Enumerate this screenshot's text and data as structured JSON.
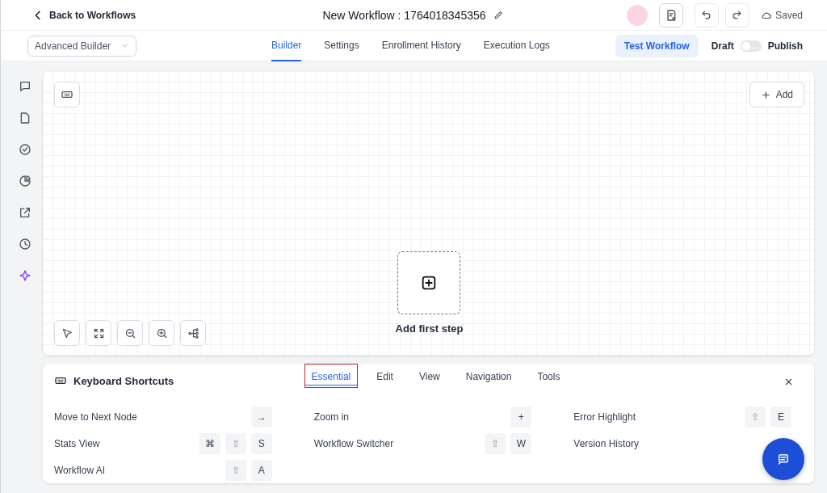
{
  "header": {
    "back_link": "Back to Workflows",
    "title": "New Workflow : 1764018345356",
    "save_status": "Saved"
  },
  "builder_select": {
    "value": "Advanced Builder"
  },
  "tabs": [
    {
      "label": "Builder",
      "selected": true
    },
    {
      "label": "Settings",
      "selected": false
    },
    {
      "label": "Enrollment History",
      "selected": false
    },
    {
      "label": "Execution Logs",
      "selected": false
    }
  ],
  "test_button": "Test Workflow",
  "publish": {
    "off_label": "Draft",
    "on_label": "Publish",
    "on": false
  },
  "sidebar": {
    "items": [
      {
        "selected": false
      },
      {
        "selected": false
      },
      {
        "selected": false
      },
      {
        "selected": false
      },
      {
        "selected": false
      },
      {
        "selected": false
      },
      {
        "selected": true
      }
    ]
  },
  "canvas": {
    "add_button": "Add",
    "empty_step": "Add first step"
  },
  "shortcuts": {
    "title": "Keyboard Shortcuts",
    "tabs": [
      {
        "label": "Essential",
        "selected": true
      },
      {
        "label": "Edit",
        "selected": false
      },
      {
        "label": "View",
        "selected": false
      },
      {
        "label": "Navigation",
        "selected": false
      },
      {
        "label": "Tools",
        "selected": false
      }
    ],
    "items": [
      {
        "label": "Move to Next Node",
        "keys": [
          {
            "label": "→",
            "kind": "key"
          }
        ]
      },
      {
        "label": "Zoom in",
        "keys": [
          {
            "label": "+",
            "kind": "key"
          }
        ]
      },
      {
        "label": "Error Highlight",
        "keys": [
          {
            "label": "⇧",
            "kind": "modifier"
          },
          {
            "label": "E",
            "kind": "key"
          }
        ]
      },
      {
        "label": "Stats View",
        "keys": [
          {
            "label": "⌘",
            "kind": "key"
          },
          {
            "label": "⇧",
            "kind": "modifier"
          },
          {
            "label": "S",
            "kind": "key"
          }
        ]
      },
      {
        "label": "Workflow Switcher",
        "keys": [
          {
            "label": "⇧",
            "kind": "modifier"
          },
          {
            "label": "W",
            "kind": "key"
          }
        ]
      },
      {
        "label": "Version History"
      },
      {
        "label": "Workflow AI",
        "keys": [
          {
            "label": "⇧",
            "kind": "modifier"
          },
          {
            "label": "A",
            "kind": "key"
          }
        ]
      }
    ]
  }
}
